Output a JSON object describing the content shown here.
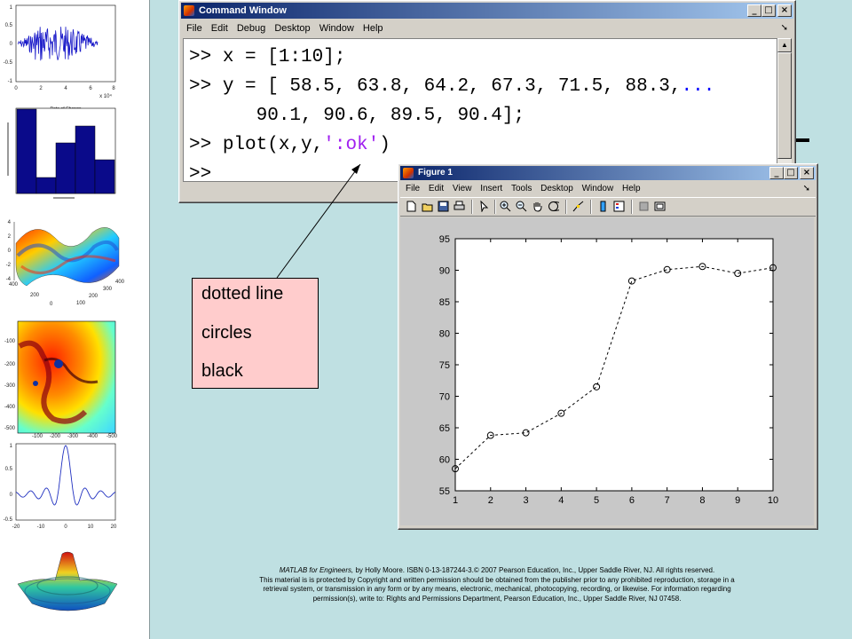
{
  "command_window": {
    "title": "Command Window",
    "menu": [
      "File",
      "Edit",
      "Debug",
      "Desktop",
      "Window",
      "Help"
    ],
    "lines": [
      {
        "prompt": ">> ",
        "code": "x = [1:10];"
      },
      {
        "prompt": ">> ",
        "code": "y = [ 58.5, 63.8, 64.2, 67.3, 71.5, 88.3,",
        "dots": "..."
      },
      {
        "prompt": "",
        "code": "      90.1, 90.6, 89.5, 90.4];"
      },
      {
        "prompt": ">> ",
        "code_a": "plot(x,y,",
        "code_str": "':ok'",
        "code_b": ")"
      },
      {
        "prompt": ">> ",
        "code": ""
      }
    ]
  },
  "figure_window": {
    "title": "Figure 1",
    "menu": [
      "File",
      "Edit",
      "View",
      "Insert",
      "Tools",
      "Desktop",
      "Window",
      "Help"
    ]
  },
  "callout": {
    "lines": [
      "dotted line",
      "circles",
      "black"
    ]
  },
  "chart_data": {
    "type": "line",
    "x": [
      1,
      2,
      3,
      4,
      5,
      6,
      7,
      8,
      9,
      10
    ],
    "series": [
      {
        "values": [
          58.5,
          63.8,
          64.2,
          67.3,
          71.5,
          88.3,
          90.1,
          90.6,
          89.5,
          90.4
        ]
      }
    ],
    "xlim": [
      1,
      10
    ],
    "ylim": [
      55,
      95
    ],
    "xticks": [
      1,
      2,
      3,
      4,
      5,
      6,
      7,
      8,
      9,
      10
    ],
    "yticks": [
      55,
      60,
      65,
      70,
      75,
      80,
      85,
      90,
      95
    ],
    "line_style": "dotted",
    "marker": "circle",
    "color": "#000000",
    "title": "",
    "xlabel": "",
    "ylabel": ""
  },
  "thumbnails": {
    "thumb1": {
      "yticks": [
        "1",
        "0.5",
        "0",
        "-0.5",
        "-1"
      ],
      "xticks": [
        "0",
        "2",
        "4",
        "6",
        "8"
      ],
      "exponent": "x 10⁴"
    },
    "thumb2": {
      "title": "Rate of Change"
    },
    "thumb3": {
      "zticks": [
        "4",
        "2",
        "0",
        "-2",
        "-4"
      ],
      "xticks": [
        "400",
        "200",
        "0"
      ],
      "yticks": [
        "100",
        "200",
        "300",
        "400"
      ]
    },
    "thumb4": {
      "yticks": [
        "-100",
        "-200",
        "-300",
        "-400",
        "-500"
      ],
      "xticks": [
        "-100",
        "-200",
        "-300",
        "-400",
        "-500"
      ]
    },
    "thumb5": {
      "yticks": [
        "1",
        "0.5",
        "0",
        "-0.5"
      ],
      "xticks": [
        "-20",
        "-10",
        "0",
        "10",
        "20"
      ]
    }
  },
  "footer": {
    "line1_italic": "MATLAB for Engineers,",
    "line1_rest": " by Holly Moore. ISBN 0-13-187244-3.© 2007 Pearson Education, Inc., Upper Saddle River, NJ.  All rights reserved.",
    "line2": "This material is is protected by Copyright and written permission should be obtained from the publisher prior to any prohibited reproduction, storage in a",
    "line3": "retrieval system, or transmission in any form or by any means, electronic, mechanical, photocopying, recording, or likewise. For information regarding",
    "line4": "permission(s), write to: Rights and Permissions Department, Pearson Education, Inc., Upper Saddle River, NJ 07458."
  }
}
